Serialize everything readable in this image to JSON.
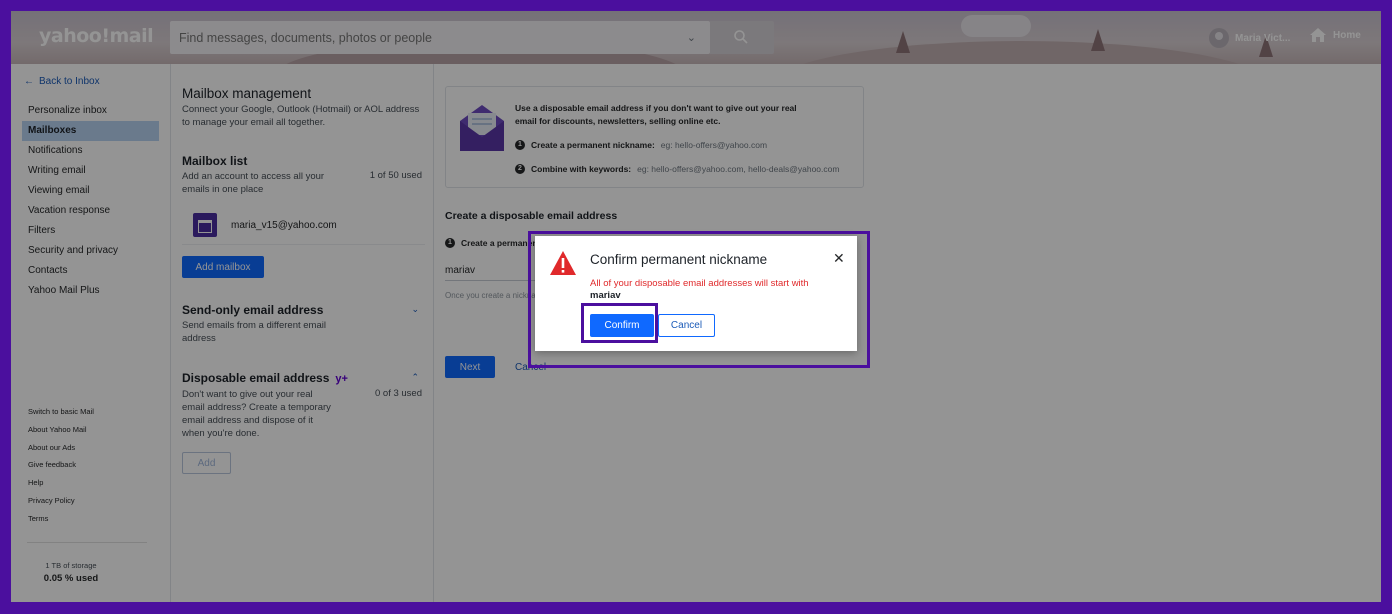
{
  "header": {
    "logo": "yahoo!mail",
    "search_placeholder": "Find messages, documents, photos or people",
    "user_name": "Maria Vict...",
    "home_label": "Home"
  },
  "leftnav": {
    "back_label": "Back to Inbox",
    "items": [
      {
        "label": "Personalize inbox"
      },
      {
        "label": "Mailboxes"
      },
      {
        "label": "Notifications"
      },
      {
        "label": "Writing email"
      },
      {
        "label": "Viewing email"
      },
      {
        "label": "Vacation response"
      },
      {
        "label": "Filters"
      },
      {
        "label": "Security and privacy"
      },
      {
        "label": "Contacts"
      },
      {
        "label": "Yahoo Mail Plus"
      }
    ],
    "footer_links": [
      {
        "label": "Switch to basic Mail"
      },
      {
        "label": "About Yahoo Mail"
      },
      {
        "label": "About our Ads"
      },
      {
        "label": "Give feedback"
      },
      {
        "label": "Help"
      },
      {
        "label": "Privacy Policy"
      },
      {
        "label": "Terms"
      }
    ],
    "storage_label": "1 TB of storage",
    "storage_used": "0.05 % used"
  },
  "mailbox_management": {
    "title": "Mailbox management",
    "description": "Connect your Google, Outlook (Hotmail) or AOL address to manage your email all together.",
    "list_title": "Mailbox list",
    "list_desc": "Add an account to access all your emails in one place",
    "list_count": "1 of 50 used",
    "mailbox_email": "maria_v15@yahoo.com",
    "add_mailbox_label": "Add mailbox",
    "send_only_title": "Send-only email address",
    "send_only_desc": "Send emails from a different email address",
    "disposable_title": "Disposable email address",
    "disposable_badge": "y+",
    "disposable_desc": "Don't want to give out your real email address? Create a temporary email address and dispose of it when you're done.",
    "disposable_count": "0 of 3 used",
    "add_label": "Add"
  },
  "disposable_panel": {
    "info_text": "Use a disposable email address if you don't want to give out your real email for discounts, newsletters, selling online etc.",
    "step1_num": "1",
    "step1_label": "Create a permanent nickname:",
    "step1_example": "eg: hello-offers@yahoo.com",
    "step2_num": "2",
    "step2_label": "Combine with keywords:",
    "step2_example": "eg: hello-offers@yahoo.com, hello-deals@yahoo.com",
    "create_title": "Create a disposable email address",
    "create_step_label": "Create a permanent nickname",
    "nickname_value": "mariav",
    "help_text": "Once you create a nickname, it can't be edited or removed.",
    "next_label": "Next",
    "cancel_label": "Cancel"
  },
  "dialog": {
    "title": "Confirm permanent nickname",
    "message": "All of your disposable email addresses will start with",
    "nickname": "mariav",
    "confirm_label": "Confirm",
    "cancel_label": "Cancel"
  },
  "colors": {
    "accent": "#0f69ff",
    "highlight_border": "#4b0f9e",
    "warning": "#e0292b"
  }
}
